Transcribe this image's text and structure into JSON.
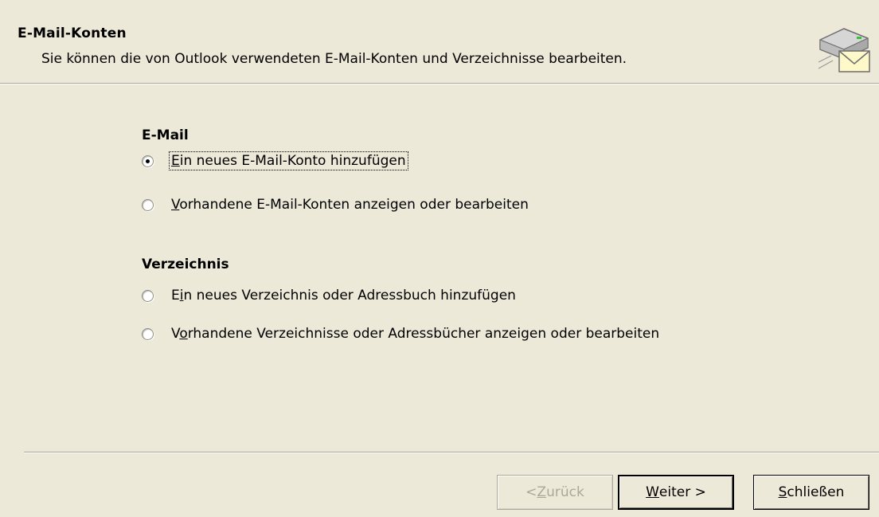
{
  "header": {
    "title": "E-Mail-Konten",
    "subtitle": "Sie können die von Outlook verwendeten E-Mail-Konten und Verzeichnisse bearbeiten.",
    "icon": "mail-server-icon"
  },
  "email_section": {
    "heading": "E-Mail",
    "options": [
      {
        "accel": "E",
        "rest": "in neues E-Mail-Konto hinzufügen",
        "checked": true,
        "focused": true
      },
      {
        "accel": "V",
        "rest": "orhandene E-Mail-Konten anzeigen oder bearbeiten",
        "checked": false
      }
    ]
  },
  "directory_section": {
    "heading": "Verzeichnis",
    "options": [
      {
        "pre": "E",
        "accel": "i",
        "rest": "n neues Verzeichnis oder Adressbuch hinzufügen",
        "checked": false
      },
      {
        "pre": "V",
        "accel": "o",
        "rest": "rhandene Verzeichnisse oder Adressbücher anzeigen oder bearbeiten",
        "checked": false
      }
    ]
  },
  "buttons": {
    "back": {
      "pre": "< ",
      "accel": "Z",
      "rest": "urück",
      "enabled": false
    },
    "next": {
      "pre": "",
      "accel": "W",
      "rest": "eiter >",
      "enabled": true
    },
    "close": {
      "pre": "",
      "accel": "S",
      "rest": "chließen",
      "enabled": true
    }
  },
  "colors": {
    "background": "#ece9d8",
    "disabled_text": "#aca899"
  }
}
